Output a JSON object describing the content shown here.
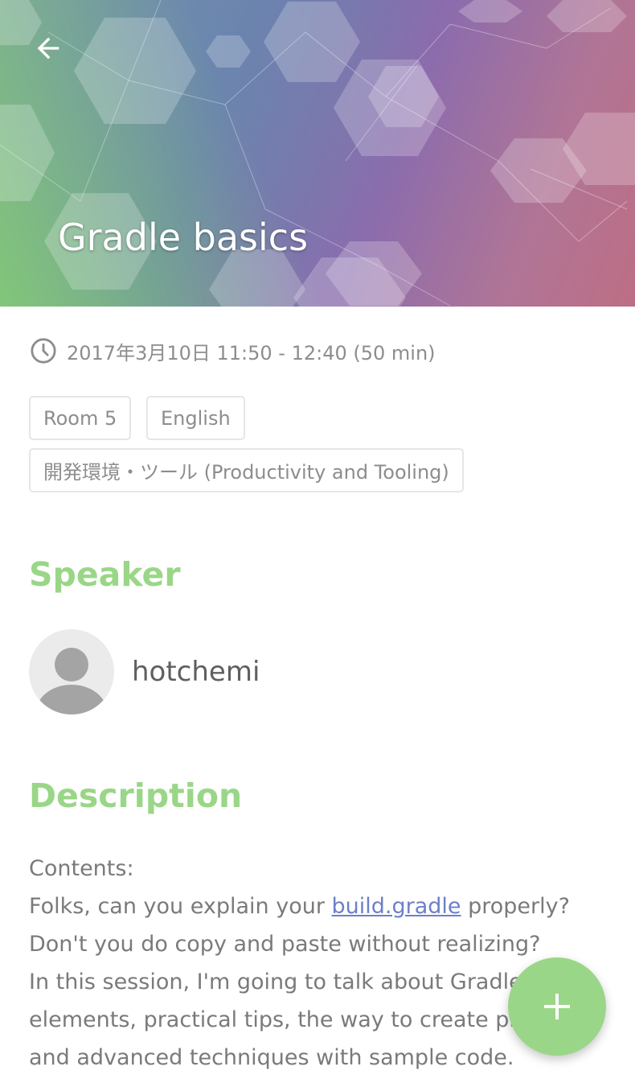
{
  "session": {
    "title": "Gradle basics",
    "time": "2017年3月10日 11:50 - 12:40 (50 min)",
    "chips": [
      "Room 5",
      "English",
      "開発環境・ツール (Productivity and Tooling)"
    ]
  },
  "speaker_section": {
    "heading": "Speaker",
    "speaker_name": "hotchemi"
  },
  "description_section": {
    "heading": "Description",
    "line1": "Contents:",
    "line2_before": "Folks, can you explain your ",
    "line2_link": "build.gradle",
    "line2_after": " properly?",
    "line3": "Don't you do copy and paste without realizing?",
    "line4": "In this session, I'm going to talk about Gradle basic",
    "line5": "elements, practical tips, the way to create plugins",
    "line6": "and advanced techniques with sample code."
  },
  "icons": {
    "back": "arrow-back-icon",
    "clock": "clock-icon",
    "avatar": "person-avatar-icon",
    "fab": "plus-icon"
  },
  "colors": {
    "accent_green": "#9ad687",
    "link": "#6d7fc9",
    "muted_text": "#8d8d8d"
  }
}
